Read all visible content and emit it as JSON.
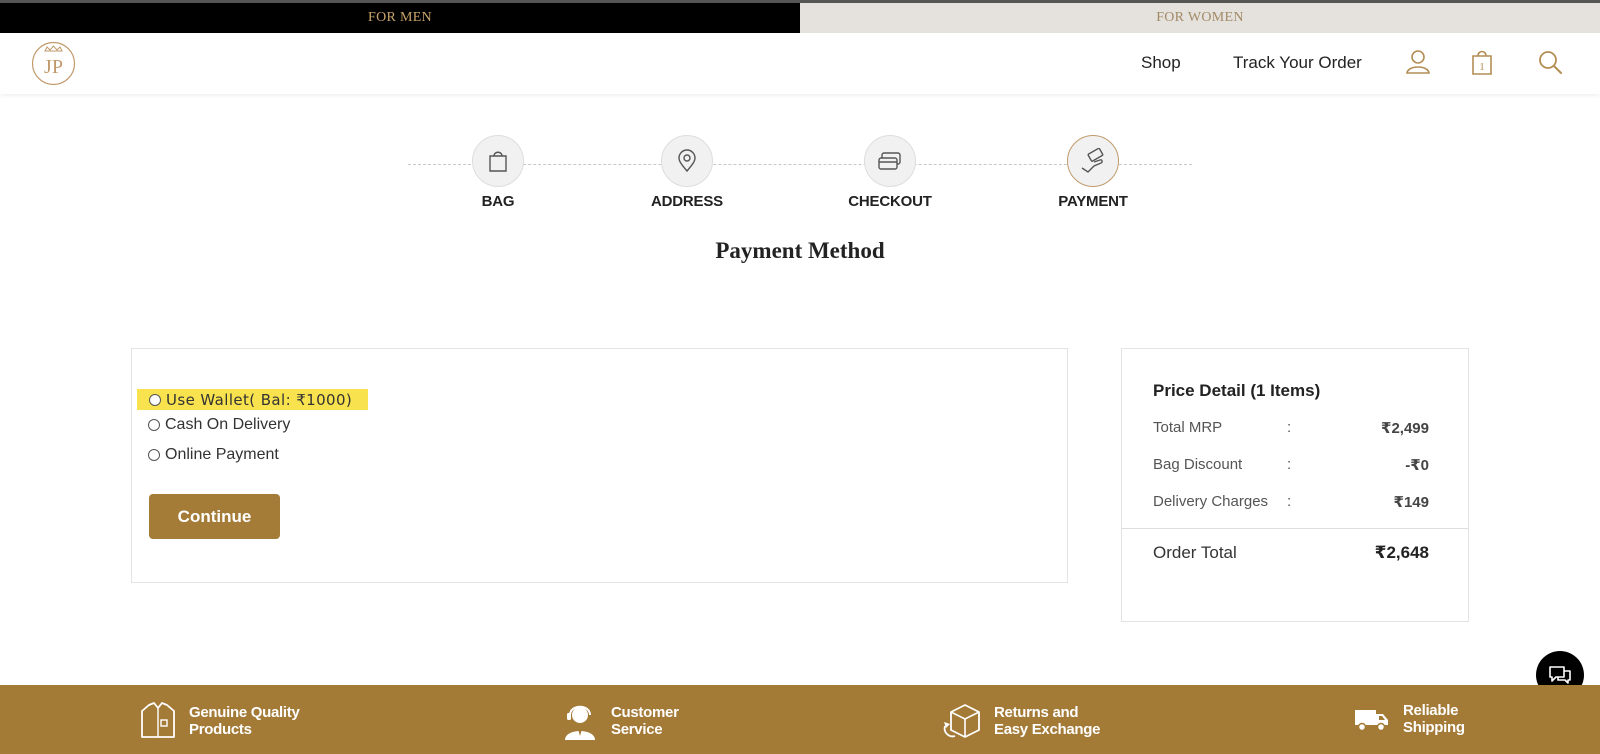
{
  "gender_bar": {
    "men_label": "FOR MEN",
    "women_label": "FOR WOMEN"
  },
  "header": {
    "logo_text": "JP",
    "nav": {
      "shop_label": "Shop",
      "track_label": "Track Your Order"
    },
    "cart_count": "1"
  },
  "steps": [
    {
      "label": "BAG",
      "icon": "bag-icon"
    },
    {
      "label": "ADDRESS",
      "icon": "location-pin-icon"
    },
    {
      "label": "CHECKOUT",
      "icon": "credit-card-icon"
    },
    {
      "label": "PAYMENT",
      "icon": "payment-hand-icon",
      "active": true
    }
  ],
  "page_title": "Payment Method",
  "payment_options": {
    "wallet": "Use Wallet( Bal: ₹1000)",
    "cod": "Cash On Delivery",
    "online": "Online Payment"
  },
  "continue_label": "Continue",
  "price_detail": {
    "title": "Price Detail (1 Items)",
    "separator": ":",
    "rows": [
      {
        "label": "Total MRP",
        "value": "₹2,499"
      },
      {
        "label": "Bag Discount",
        "value": "-₹0"
      },
      {
        "label": "Delivery Charges",
        "value": "₹149"
      }
    ],
    "total_label": "Order Total",
    "total_value": "₹2,648"
  },
  "footer": {
    "features": [
      {
        "line1": "Genuine Quality",
        "line2": "Products",
        "icon": "shirt-icon"
      },
      {
        "line1": "Customer",
        "line2": "Service",
        "icon": "support-agent-icon"
      },
      {
        "line1": "Returns and",
        "line2": "Easy Exchange",
        "icon": "returns-box-icon"
      },
      {
        "line1": "Reliable",
        "line2": "Shipping",
        "icon": "truck-icon"
      }
    ]
  },
  "colors": {
    "accent": "#a47a37",
    "highlight": "#f8e24e",
    "gold": "#c09a6b"
  }
}
